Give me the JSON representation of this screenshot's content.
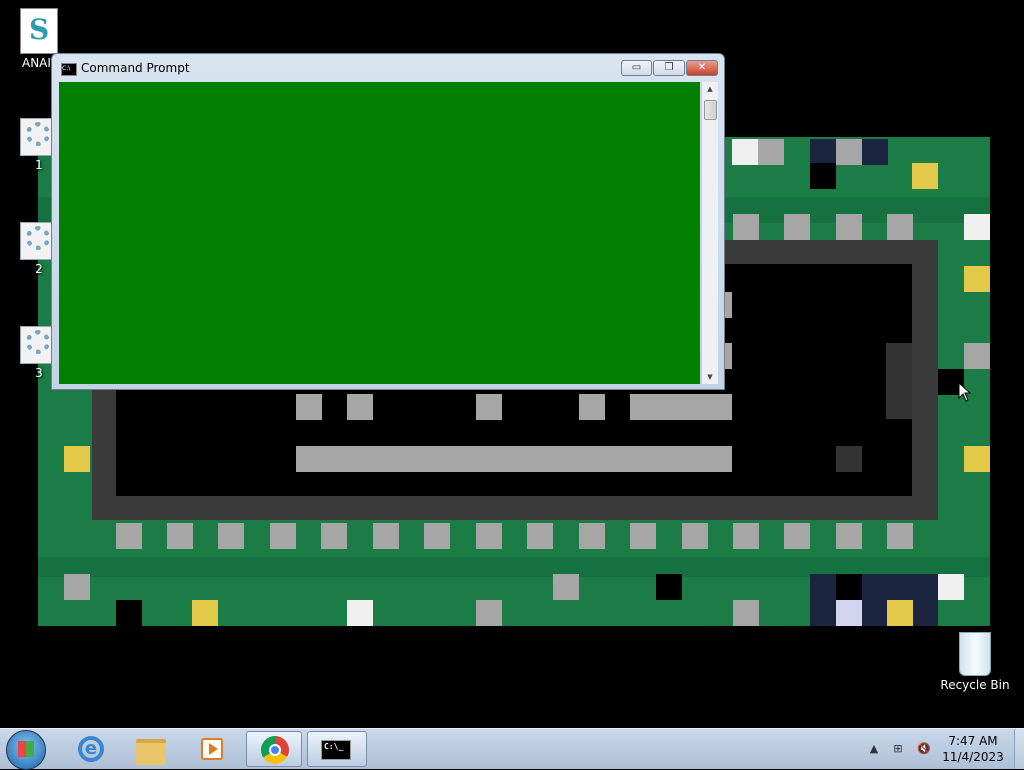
{
  "desktop": {
    "icons": [
      {
        "label": "ANAI",
        "icon": "script-file-icon"
      },
      {
        "label": "1",
        "icon": "gear-settings-icon"
      },
      {
        "label": "2",
        "icon": "gear-settings-icon"
      },
      {
        "label": "3",
        "icon": "gear-settings-icon"
      },
      {
        "label": "Recycle Bin",
        "icon": "recycle-bin-icon"
      }
    ]
  },
  "window": {
    "title": "Command Prompt",
    "minimize": "▭",
    "maximize": "❐",
    "close": "✕",
    "console_color": "#008000",
    "scroll_up": "▲",
    "scroll_down": "▼"
  },
  "taskbar": {
    "pinned": [
      "start-orb-icon",
      "internet-explorer-icon",
      "file-explorer-icon",
      "media-player-icon",
      "chrome-icon",
      "command-prompt-icon"
    ],
    "cmd_glyph": "C:\\_",
    "tray": {
      "arrow": "▲",
      "network": "⊞",
      "volume": "🔇"
    },
    "clock": {
      "time": "7:47 AM",
      "date": "11/4/2023"
    }
  }
}
